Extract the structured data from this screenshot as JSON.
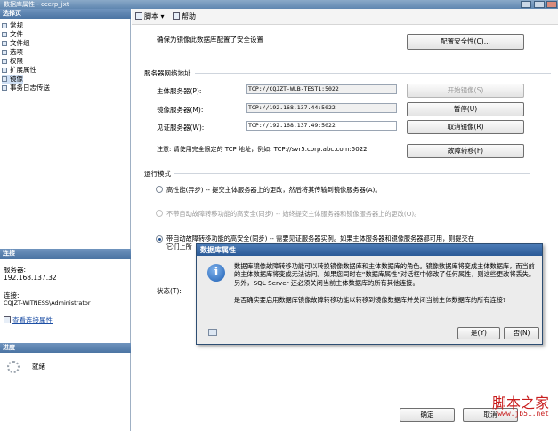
{
  "window": {
    "title": "数据库属性 - ccerp_jxt"
  },
  "left": {
    "select_page_header": "选择页",
    "pages": [
      "常规",
      "文件",
      "文件组",
      "选项",
      "权限",
      "扩展属性",
      "镜像",
      "事务日志传送"
    ],
    "selected_page": "镜像",
    "connection_header": "连接",
    "server_label": "服务器:",
    "server_value": "192.168.137.32",
    "connection_label": "连接:",
    "connection_value": "CQJZT-WITNESS\\Administrator",
    "view_props_link": "查看连接属性",
    "progress_header": "进度",
    "progress_status": "就绪"
  },
  "toolbar": {
    "script_label": "脚本",
    "help_label": "帮助"
  },
  "main": {
    "security_note": "确保为镜像此数据库配置了安全设置",
    "config_security_button": "配置安全性(C)...",
    "network_group": "服务器网络地址",
    "principal_label": "主体服务器(P):",
    "principal_value": "TCP://CQJZT-WLB-TEST1:5022",
    "mirror_label": "镜像服务器(M):",
    "mirror_value": "TCP://192.168.137.44:5022",
    "witness_label": "见证服务器(W):",
    "witness_value": "TCP://192.168.137.49:5022",
    "start_mirror_button": "开始镜像(S)",
    "pause_button": "暂停(U)",
    "remove_mirror_button": "取消镜像(R)",
    "failover_button": "故障转移(F)",
    "note": "注意: 请使用完全限定的 TCP 地址，例如: TCP://svr5.corp.abc.com:5022",
    "operating_mode_group": "运行模式",
    "mode_high_performance": "高性能(异步) -- 提交主体服务器上的更改，然后将其传输到镜像服务器(A)。",
    "mode_high_safety_no_failover": "不带自动故障转移功能的高安全(同步) -- 始终提交主体服务器和镜像服务器上的更改(O)。",
    "mode_high_safety_auto": "带自动故障转移功能的高安全(同步) -- 需要见证服务器实例。如果主体服务器和镜像服务器都可用，则提交在",
    "mode_high_safety_auto_line2": "它们上所",
    "status_label": "状态(T):",
    "ok_button": "确定",
    "cancel_button": "取消"
  },
  "dialog": {
    "title": "数据库属性",
    "icon": "info-icon",
    "message": "数据库镜像故障转移功能可以转换镜像数据库和主体数据库的角色。镜像数据库将变成主体数据库，而当前的主体数据库将变成无法访问。如果您同时在“数据库属性”对话框中修改了任何属性，则这些更改将丢失。另外，SQL Server 还必须关闭当前主体数据库的所有其他连接。",
    "question": "是否确实要启用数据库镜像故障转移功能以转移到镜像数据库并关闭当前主体数据库的所有连接?",
    "yes_button": "是(Y)",
    "no_button": "否(N)"
  },
  "watermark": {
    "brand": "脚本之家",
    "url": "www.jb51.net"
  }
}
